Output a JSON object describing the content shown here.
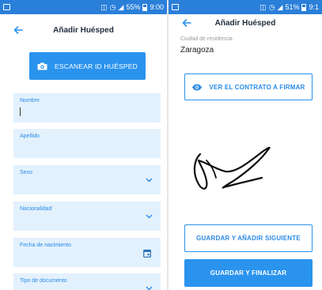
{
  "left": {
    "statusbar": {
      "signal": "📶",
      "battery_pct": "55%",
      "time": "9:00"
    },
    "appbar": {
      "title": "Añadir Huésped"
    },
    "scan_button": {
      "label": "ESCANEAR ID HUÉSPED",
      "icon": "camera-icon"
    },
    "fields": [
      {
        "label": "Nombre",
        "type": "text",
        "focused": true
      },
      {
        "label": "Apellido",
        "type": "text"
      },
      {
        "label": "Sexo",
        "type": "select"
      },
      {
        "label": "Nacionalidad",
        "type": "select"
      },
      {
        "label": "Fecha de nacimiento",
        "type": "date"
      },
      {
        "label": "Tipo de documento",
        "type": "select"
      }
    ]
  },
  "right": {
    "statusbar": {
      "signal": "📶",
      "battery_pct": "51%",
      "time": "9:1"
    },
    "appbar": {
      "title": "Añadir Huésped"
    },
    "city": {
      "label": "Ciudad de residencia",
      "value": "Zaragoza"
    },
    "contract_button": {
      "label": "VER EL CONTRATO A FIRMAR",
      "icon": "eye-icon"
    },
    "save_next_button": {
      "label": "GUARDAR Y AÑADIR SIGUIENTE"
    },
    "save_finish_button": {
      "label": "GUARDAR Y FINALIZAR"
    }
  },
  "colors": {
    "primary": "#2a93ee",
    "statusbar": "#2a7fd9",
    "field_bg": "#e3f1fd",
    "label": "#2a8be6"
  }
}
